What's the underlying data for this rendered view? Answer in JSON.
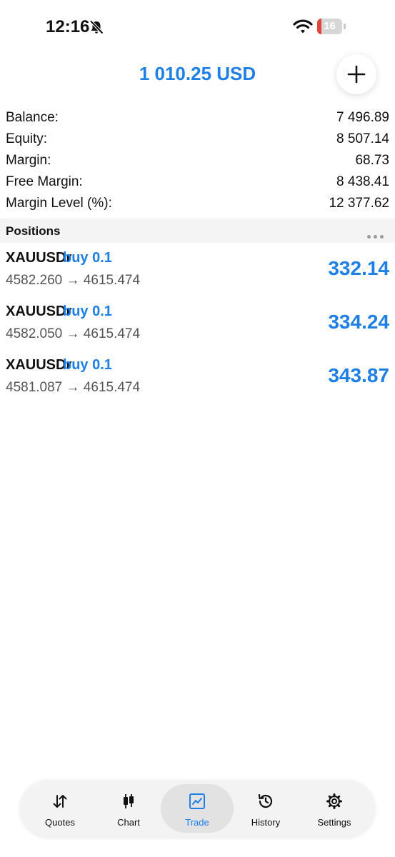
{
  "status_bar": {
    "time": "12:16",
    "battery": "16",
    "battery_level_percent": 16
  },
  "header": {
    "amount": "1 010.25 USD"
  },
  "summary": [
    {
      "label": "Balance:",
      "value": "7 496.89"
    },
    {
      "label": "Equity:",
      "value": "8 507.14"
    },
    {
      "label": "Margin:",
      "value": "68.73"
    },
    {
      "label": "Free Margin:",
      "value": "8 438.41"
    },
    {
      "label": "Margin Level (%):",
      "value": "12 377.62"
    }
  ],
  "positions": {
    "title": "Positions",
    "items": [
      {
        "symbol": "XAUUSDr",
        "side": "buy 0.1",
        "prices": "4582.260 → 4615.474",
        "profit": "332.14"
      },
      {
        "symbol": "XAUUSDr",
        "side": "buy 0.1",
        "prices": "4582.050 → 4615.474",
        "profit": "334.24"
      },
      {
        "symbol": "XAUUSDr",
        "side": "buy 0.1",
        "prices": "4581.087 → 4615.474",
        "profit": "343.87"
      }
    ]
  },
  "tabs": [
    {
      "label": "Quotes",
      "icon": "quotes-icon",
      "active": false
    },
    {
      "label": "Chart",
      "icon": "chart-icon",
      "active": false
    },
    {
      "label": "Trade",
      "icon": "trade-icon",
      "active": true
    },
    {
      "label": "History",
      "icon": "history-icon",
      "active": false
    },
    {
      "label": "Settings",
      "icon": "settings-icon",
      "active": false
    }
  ],
  "colors": {
    "accent": "#1e7fe6",
    "battery_low": "#e0443a",
    "section_bg": "#f4f4f4"
  }
}
